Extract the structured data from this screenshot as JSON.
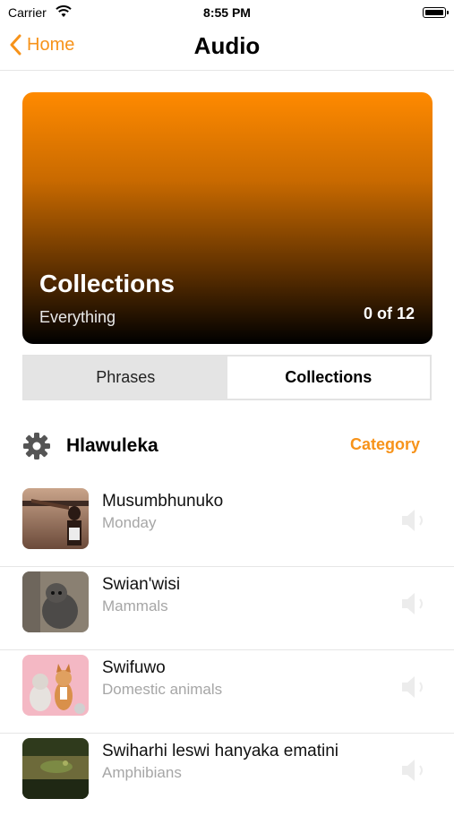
{
  "status": {
    "carrier": "Carrier",
    "time": "8:55 PM"
  },
  "nav": {
    "back_label": "Home",
    "title": "Audio"
  },
  "hero": {
    "title": "Collections",
    "subtitle": "Everything",
    "count": "0 of 12"
  },
  "tabs": [
    {
      "label": "Phrases",
      "selected": false
    },
    {
      "label": "Collections",
      "selected": true
    }
  ],
  "filter": {
    "label": "Hlawuleka",
    "action": "Category"
  },
  "items": [
    {
      "title": "Musumbhunuko",
      "subtitle": "Monday",
      "icon": "speaker-icon"
    },
    {
      "title": "Swian'wisi",
      "subtitle": "Mammals",
      "icon": "speaker-icon"
    },
    {
      "title": "Swifuwo",
      "subtitle": "Domestic animals",
      "icon": "speaker-icon"
    },
    {
      "title": "Swiharhi leswi hanyaka ematini",
      "subtitle": "Amphibians",
      "icon": "speaker-icon"
    }
  ],
  "colors": {
    "accent": "#f7931a",
    "hero_top": "#ff8a00",
    "hero_bottom": "#000000"
  }
}
